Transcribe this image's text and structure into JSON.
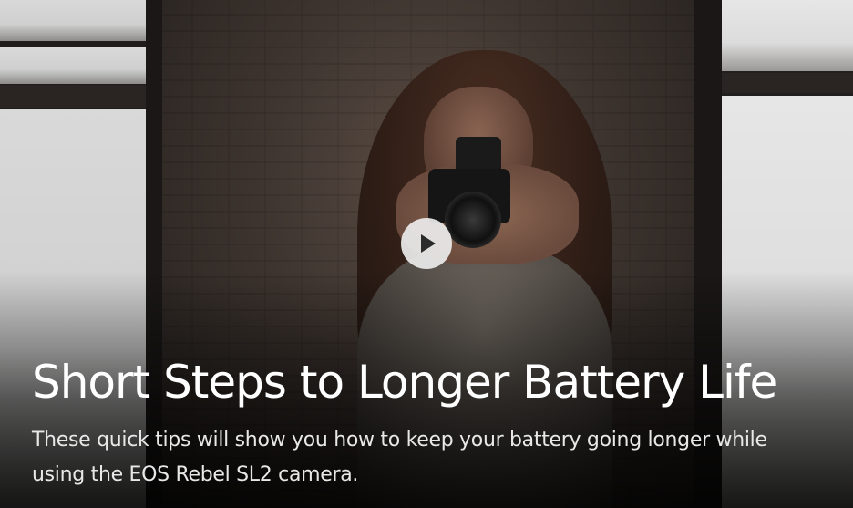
{
  "video": {
    "title": "Short Steps to Longer Battery Life",
    "description": "These quick tips will show you how to keep your battery going longer while using the EOS Rebel SL2 camera."
  },
  "icons": {
    "play": "play-icon"
  },
  "colors": {
    "title_text": "#ffffff",
    "description_text": "#e8e8e8",
    "play_button_bg": "#ebebeb",
    "play_icon": "#2b2b2b"
  }
}
